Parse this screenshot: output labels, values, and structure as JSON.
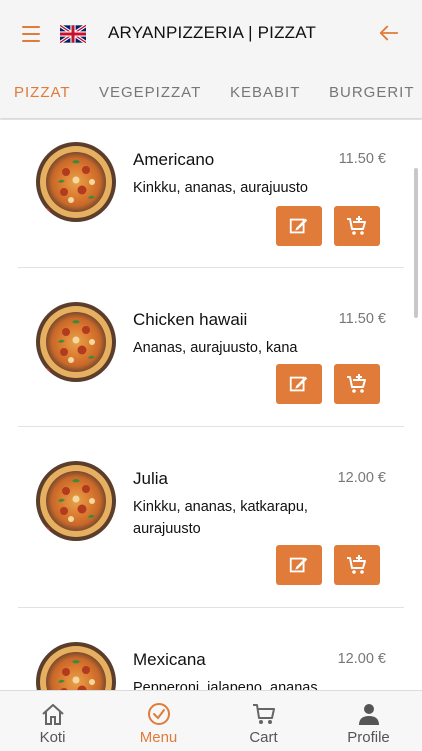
{
  "header": {
    "title": "ARYANPIZZERIA | PIZZAT",
    "accent": "#e07b39"
  },
  "tabs": [
    {
      "label": "PIZZAT",
      "active": true
    },
    {
      "label": "VEGEPIZZAT",
      "active": false
    },
    {
      "label": "KEBABIT",
      "active": false
    },
    {
      "label": "BURGERIT",
      "active": false
    }
  ],
  "items": [
    {
      "name": "Americano",
      "price": "11.50 €",
      "desc": "Kinkku, ananas, aurajuusto"
    },
    {
      "name": "Chicken hawaii",
      "price": "11.50 €",
      "desc": "Ananas, aurajuusto, kana"
    },
    {
      "name": "Julia",
      "price": "12.00 €",
      "desc": "Kinkku, ananas, katkarapu, aurajuusto"
    },
    {
      "name": "Mexicana",
      "price": "12.00 €",
      "desc": "Pepperoni, jalapeno, ananas,"
    }
  ],
  "icons": {
    "edit": "edit-icon",
    "add_to_cart": "add-to-cart-icon"
  },
  "nav": [
    {
      "label": "Koti",
      "icon": "home-icon",
      "active": false
    },
    {
      "label": "Menu",
      "icon": "check-circle-icon",
      "active": true
    },
    {
      "label": "Cart",
      "icon": "cart-icon",
      "active": false
    },
    {
      "label": "Profile",
      "icon": "person-icon",
      "active": false
    }
  ]
}
